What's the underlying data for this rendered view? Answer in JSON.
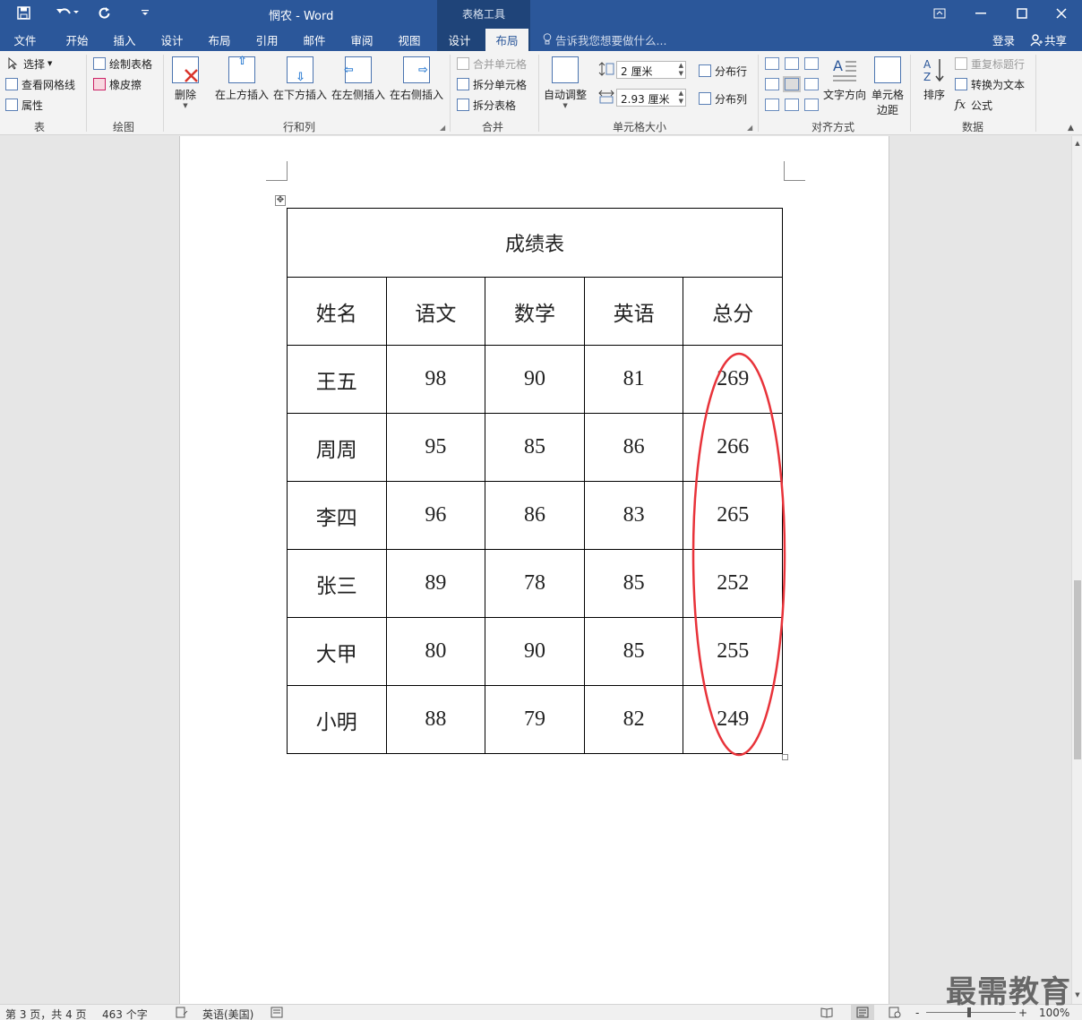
{
  "app": {
    "title": "惘农 - Word",
    "table_tools": "表格工具",
    "icons": {
      "save": "save-icon",
      "undo": "undo-icon",
      "redo": "redo-icon",
      "customize": "customize-qat-icon"
    },
    "window_buttons": {
      "restore_ribbon": "▣",
      "minimize": "—",
      "maximize": "☐",
      "close": "✕"
    }
  },
  "tabs": [
    "文件",
    "开始",
    "插入",
    "设计",
    "布局",
    "引用",
    "邮件",
    "审阅",
    "视图",
    "设计",
    "布局"
  ],
  "active_tab_index": 10,
  "tell_me": "告诉我您想要做什么...",
  "login": "登录",
  "share": "共享",
  "ribbon": {
    "table": {
      "label": "表",
      "select": "选择",
      "view_gridlines": "查看网格线",
      "properties": "属性"
    },
    "draw": {
      "label": "绘图",
      "draw_table": "绘制表格",
      "eraser": "橡皮擦"
    },
    "rows_cols": {
      "label": "行和列",
      "delete": "删除",
      "insert_above": "在上方插入",
      "insert_below": "在下方插入",
      "insert_left": "在左侧插入",
      "insert_right": "在右侧插入"
    },
    "merge": {
      "label": "合并",
      "merge_cells": "合并单元格",
      "split_cells": "拆分单元格",
      "split_table": "拆分表格"
    },
    "cell_size": {
      "label": "单元格大小",
      "autofit": "自动调整",
      "height": "2 厘米",
      "width": "2.93 厘米",
      "distribute_rows": "分布行",
      "distribute_cols": "分布列"
    },
    "alignment": {
      "label": "对齐方式",
      "text_direction": "文字方向",
      "cell_margins_1": "单元格",
      "cell_margins_2": "边距"
    },
    "data": {
      "label": "数据",
      "sort": "排序",
      "repeat_header": "重复标题行",
      "convert_to_text": "转换为文本",
      "formula": "公式"
    }
  },
  "table": {
    "title": "成绩表",
    "headers": [
      "姓名",
      "语文",
      "数学",
      "英语",
      "总分"
    ],
    "rows": [
      [
        "王五",
        "98",
        "90",
        "81",
        "269"
      ],
      [
        "周周",
        "95",
        "85",
        "86",
        "266"
      ],
      [
        "李四",
        "96",
        "86",
        "83",
        "265"
      ],
      [
        "张三",
        "89",
        "78",
        "85",
        "252"
      ],
      [
        "大甲",
        "80",
        "90",
        "85",
        "255"
      ],
      [
        "小明",
        "88",
        "79",
        "82",
        "249"
      ]
    ],
    "highlight_color": "#e8333a"
  },
  "status": {
    "page": "第 3 页，共 4 页",
    "words": "463 个字",
    "language": "英语(美国)",
    "zoom": "100%",
    "minus": "-",
    "plus": "+"
  },
  "watermark": "最需教育"
}
